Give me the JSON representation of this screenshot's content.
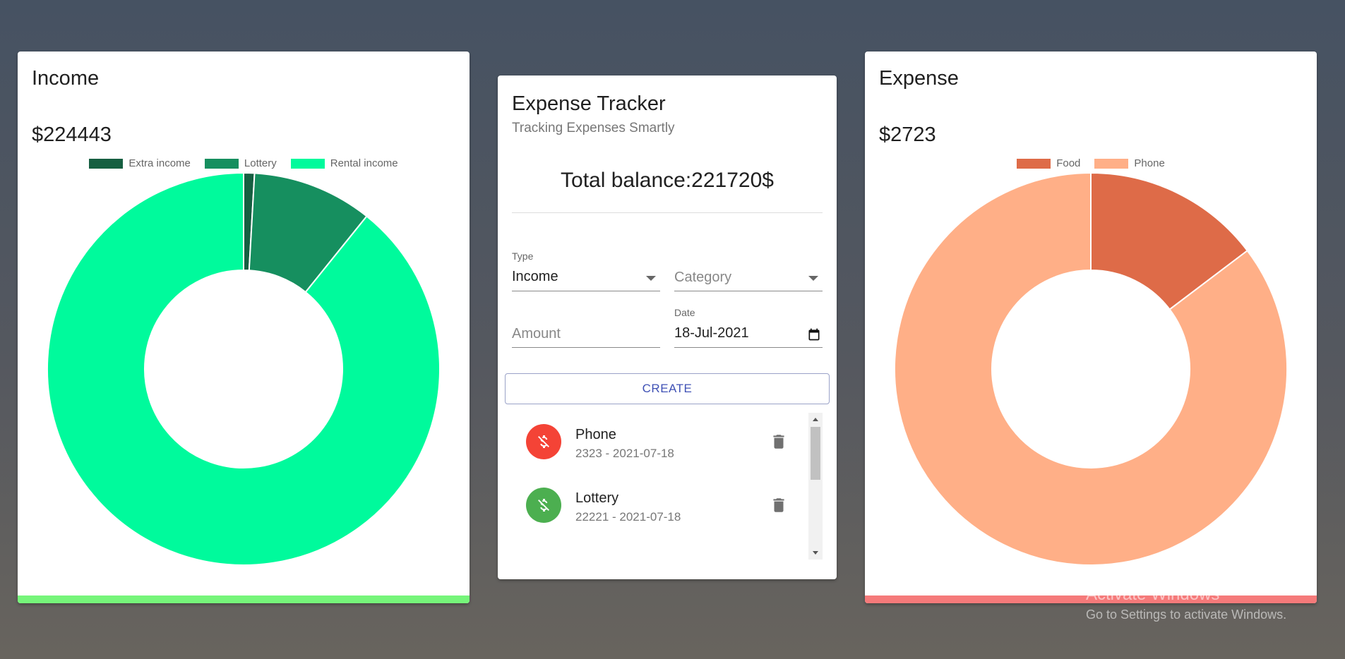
{
  "income": {
    "title": "Income",
    "amount": "$224443",
    "bar_color": "#76f57a",
    "chart_data": {
      "type": "pie",
      "donut": true,
      "categories": [
        "Extra income",
        "Lottery",
        "Rental income"
      ],
      "values": [
        2000,
        22221,
        200222
      ],
      "colors": [
        "#165f41",
        "#168f5f",
        "#00fa9c"
      ],
      "legend_position": "top"
    }
  },
  "tracker": {
    "title": "Expense Tracker",
    "subtitle": "Tracking Expenses Smartly",
    "balance": "Total balance:221720$",
    "type_label": "Type",
    "type_value": "Income",
    "category_placeholder": "Category",
    "amount_placeholder": "Amount",
    "date_label": "Date",
    "date_value": "18-Jul-2021",
    "create_label": "CREATE",
    "transactions": [
      {
        "title": "Phone",
        "subtitle": "2323 - 2021-07-18",
        "color": "#f44336",
        "icon": "money-off-icon"
      },
      {
        "title": "Lottery",
        "subtitle": "22221 - 2021-07-18",
        "color": "#4caf50",
        "icon": "money-off-icon"
      }
    ]
  },
  "expense": {
    "title": "Expense",
    "amount": "$2723",
    "bar_color": "#f57a7a",
    "chart_data": {
      "type": "pie",
      "donut": true,
      "categories": [
        "Food",
        "Phone"
      ],
      "values": [
        400,
        2323
      ],
      "colors": [
        "#de6b48",
        "#ffaf87"
      ],
      "legend_position": "top"
    }
  },
  "watermark": {
    "line1": "Activate Windows",
    "line2": "Go to Settings to activate Windows."
  }
}
